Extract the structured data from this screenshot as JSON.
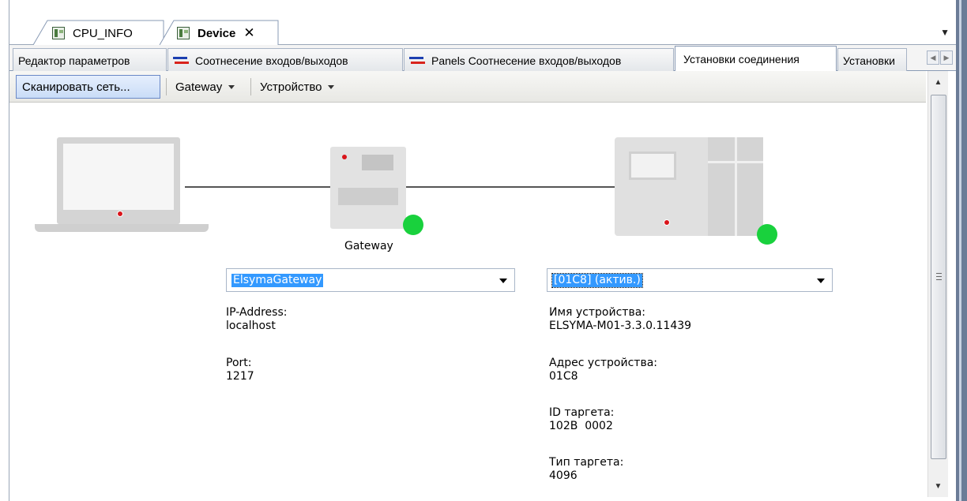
{
  "editor_tabs": [
    {
      "label": "CPU_INFO",
      "active": false
    },
    {
      "label": "Device",
      "active": true,
      "close": "✕"
    }
  ],
  "page_tabs": [
    {
      "label": "Редактор параметров",
      "icon": ""
    },
    {
      "label": "Соотнесение входов/выходов",
      "icon": "io-mapping-icon"
    },
    {
      "label": "Panels Соотнесение входов/выходов",
      "icon": "io-mapping-icon"
    },
    {
      "label": "Установки соединения",
      "active": true
    },
    {
      "label": "Установки"
    }
  ],
  "toolbar": {
    "scan": "Сканировать сеть...",
    "gateway": "Gateway",
    "device": "Устройство"
  },
  "gateway": {
    "label": "Gateway",
    "selected": "ElsymaGateway",
    "ip_label": "IP-Address:",
    "ip_value": "localhost",
    "port_label": "Port:",
    "port_value": "1217",
    "status_color": "#19d13d"
  },
  "device": {
    "selected": "[01C8] (актив.)",
    "name_label": "Имя устройства:",
    "name_value": "ELSYMA-M01-3.3.0.11439",
    "address_label": "Адрес устройства:",
    "address_value": "01C8",
    "target_id_label": "ID таргета:",
    "target_id_value": "102B  0002",
    "target_type_label": "Тип таргета:",
    "target_type_value": "4096",
    "status_color": "#19d13d"
  }
}
